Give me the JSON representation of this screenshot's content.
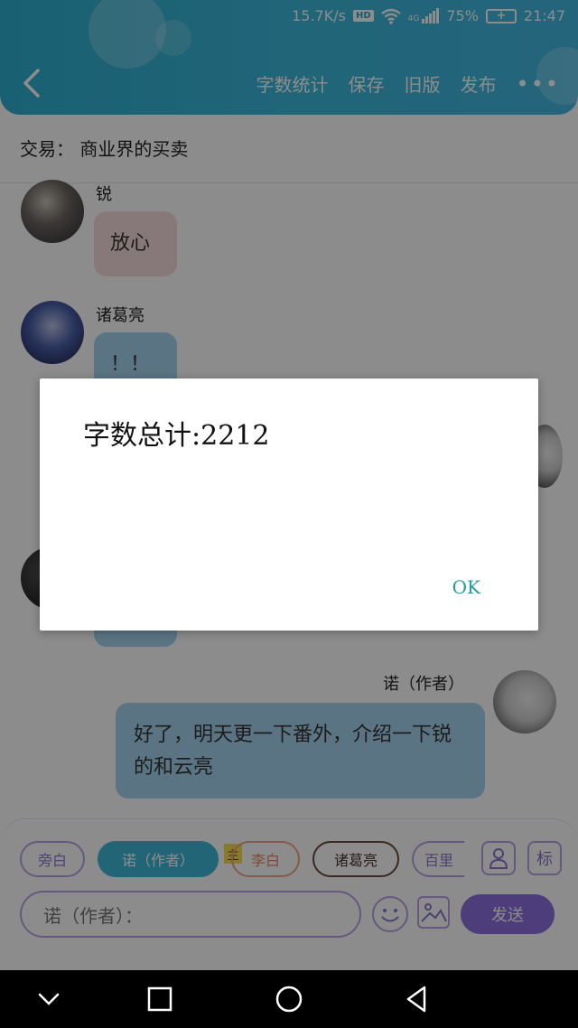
{
  "status_bar": {
    "net_speed": "15.7K/s",
    "hd": "HD",
    "signal": "4G",
    "battery": "75%",
    "time": "21:47"
  },
  "toolbar": {
    "items": [
      "字数统计",
      "保存",
      "旧版",
      "发布"
    ],
    "more": "•••"
  },
  "subtitle": "交易： 商业界的买卖",
  "messages": [
    {
      "sender": "锐",
      "text": "放心"
    },
    {
      "sender": "诸葛亮",
      "text": "！！"
    },
    {
      "sender": "诺（作者）",
      "text": "好了，明天更一下番外，介绍一下锐的和云亮"
    }
  ],
  "chips": [
    "旁白",
    "诺（作者）",
    "李白",
    "诸葛亮",
    "百里"
  ],
  "tag": "主",
  "side_buttons": {
    "person": "",
    "label": "标"
  },
  "input": {
    "text": "诺（作者）："
  },
  "send": "发送",
  "dialog": {
    "message": "字数总计:2212",
    "ok": "OK"
  },
  "colors": {
    "header": "#3bb8db",
    "accent": "#8d6fe0",
    "chip_border": "#b9a3e6",
    "ok_text": "#219c9c"
  }
}
